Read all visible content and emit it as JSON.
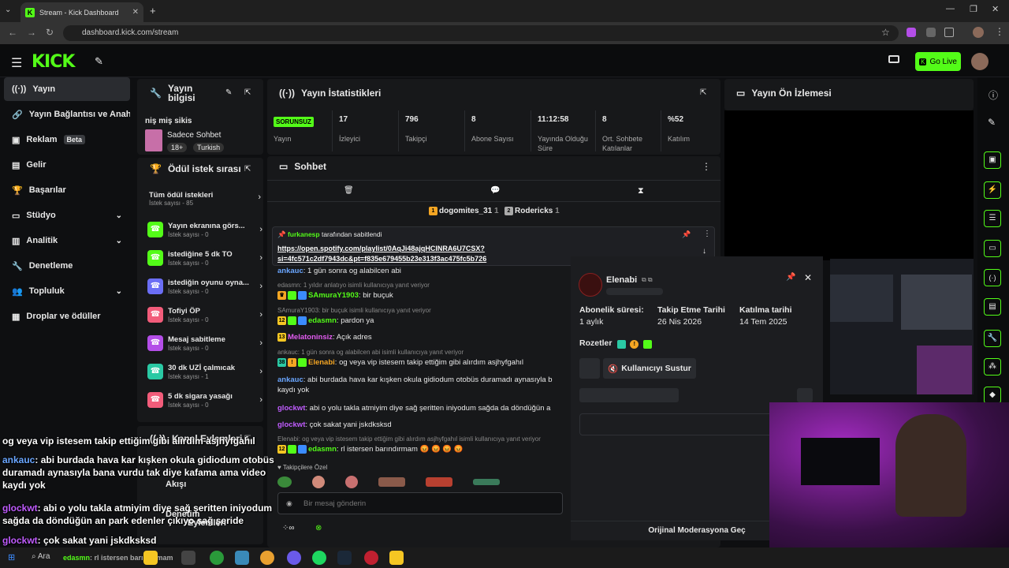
{
  "browser": {
    "tab_title": "Stream - Kick Dashboard",
    "url": "dashboard.kick.com/stream"
  },
  "header": {
    "logo": "KICK",
    "go_live": "Go Live"
  },
  "sidebar": {
    "items": [
      {
        "label": "Yayın",
        "icon": "broadcast-icon"
      },
      {
        "label": "Yayın Bağlantısı ve Anahtarı",
        "icon": "link-icon"
      },
      {
        "label": "Reklam",
        "icon": "ad-icon",
        "badge": "Beta"
      },
      {
        "label": "Gelir",
        "icon": "wallet-icon"
      },
      {
        "label": "Başarılar",
        "icon": "trophy-icon"
      },
      {
        "label": "Stüdyo",
        "icon": "studio-icon"
      },
      {
        "label": "Analitik",
        "icon": "chart-icon"
      },
      {
        "label": "Denetleme",
        "icon": "wrench-icon"
      },
      {
        "label": "Topluluk",
        "icon": "community-icon"
      },
      {
        "label": "Droplar ve ödüller",
        "icon": "drops-icon"
      }
    ]
  },
  "stream_info": {
    "title": "Yayın bilgisi",
    "stream_title": "niş miş sikis",
    "category": "Sadece Sohbet",
    "tags": [
      "18+",
      "Turkish"
    ]
  },
  "rewards": {
    "title": "Ödül istek sırası",
    "all_label": "Tüm ödül istekleri",
    "all_count": "İstek sayısı - 85",
    "items": [
      {
        "label": "Yayın ekranına görs...",
        "count": "İstek sayısı - 0",
        "color": "#53fc18"
      },
      {
        "label": "istediğine 5 dk TO",
        "count": "İstek sayısı - 0",
        "color": "#53fc18"
      },
      {
        "label": "istediğin oyunu oyna...",
        "count": "İstek sayısı - 0",
        "color": "#6b6ef5"
      },
      {
        "label": "Tofiyi ÖP",
        "count": "İstek sayısı - 0",
        "color": "#f25c7a"
      },
      {
        "label": "Mesaj sabitleme",
        "count": "İstek sayısı - 0",
        "color": "#b44ee8"
      },
      {
        "label": "30 dk UZİ çalmıcak",
        "count": "İstek sayısı - 1",
        "color": "#2ac9a4"
      },
      {
        "label": "5 dk sigara yasağı",
        "count": "İstek sayısı - 0",
        "color": "#f25c7a"
      }
    ]
  },
  "channel_actions": {
    "title": "Kanal Eylemleri"
  },
  "stats": {
    "title": "Yayın İstatistikleri",
    "items": [
      {
        "value": "SORUNSUZ",
        "label": "Yayın"
      },
      {
        "value": "17",
        "label": "İzleyici"
      },
      {
        "value": "796",
        "label": "Takipçi"
      },
      {
        "value": "8",
        "label": "Abone Sayısı"
      },
      {
        "value": "11:12:58",
        "label": "Yayında Olduğu Süre"
      },
      {
        "value": "8",
        "label": "Ort. Sohbete Katılanlar"
      },
      {
        "value": "%52",
        "label": "Katılım"
      }
    ]
  },
  "preview": {
    "title": "Yayın Ön İzlemesi"
  },
  "chat": {
    "title": "Sohbet",
    "top_gifters": [
      {
        "name": "dogomites_31",
        "count": "1"
      },
      {
        "name": "Rodericks",
        "count": "1"
      }
    ],
    "pinned_by": "furkanesp",
    "pinned_suffix": "tarafından sabitlendi",
    "pinned_link_1": "https://open.spotify.com/playlist/0AqJi48ajqHCINRA6U7CSX?",
    "pinned_link_2": "si=4fc571c2df7943dc&pt=f835e679455b23e313f3ac475fc5b726",
    "messages": [
      {
        "reply": "",
        "user": "ankauc",
        "text": "1 gün sonra og alabilcen abi",
        "color": "#6aa6ff"
      },
      {
        "reply": "edasmn: 1 yıldır anlatıyo isimli kullanıcıya yanıt veriyor",
        "user": "SAmuraY1903",
        "text": "bir buçuk",
        "color": "#53fc18"
      },
      {
        "reply": "SAmuraY1903: bir buçuk isimli kullanıcıya yanıt veriyor",
        "user": "edasmn",
        "text": "pardon ya",
        "color": "#53fc18"
      },
      {
        "reply": "",
        "user": "Melatoninsiz",
        "text": "Açık adres",
        "color": "#e25cf0"
      },
      {
        "reply": "ankauc: 1 gün sonra og alabilcen abi isimli kullanıcıya yanıt veriyor",
        "user": "Elenabi",
        "text": "og veya vip istesem takip ettiğim gibi alırdım asjhyfgahıl",
        "color": "#f5a623"
      },
      {
        "reply": "",
        "user": "ankauc",
        "text": "abi burdada hava kar kışken okula gidiodum otobüs duramadı aynasıyla b",
        "text2": "kaydı yok",
        "color": "#6aa6ff"
      },
      {
        "reply": "",
        "user": "glockwt",
        "text": "abi o yolu takla atmiyim diye sağ şeritten iniyodum sağda da döndüğün a",
        "color": "#c05cff"
      },
      {
        "reply": "",
        "user": "glockwt",
        "text": "çok sakat yani jskdksksd",
        "color": "#c05cff"
      },
      {
        "reply": "Elenabi: og veya vip istesem takip ettiğim gibi alırdım asjhyfgahıl isimli kullanıcıya yanıt veriyor",
        "user": "edasmn",
        "text": "rl istersen barındırmam 😡 😡 😡 😡",
        "color": "#53fc18"
      }
    ],
    "followers_only": "Takipçilere Özel",
    "input_placeholder": "Bir mesaj gönderin"
  },
  "profile": {
    "username": "Elenabi",
    "sub_label": "Abonelik süresi:",
    "sub_value": "1 aylık",
    "follow_label": "Takip Etme Tarihi",
    "follow_value": "26 Nis 2026",
    "join_label": "Katılma tarihi",
    "join_value": "14 Tem 2025",
    "badges_label": "Rozetler",
    "mute_button": "Kullanıcıyı Sustur",
    "footer_button": "Orijinal Moderasyona Geç"
  },
  "overlay_chat": [
    {
      "user": "edasmn",
      "text": "",
      "color": "#53fc18"
    },
    {
      "user": "Elenabi",
      "text": "og veya vip istesem takip ettiğim gibi alırdım asjhyfgahıl",
      "color": "#f5a623"
    },
    {
      "user": "ankauc",
      "text": ": abi burdada hava kar kışken okula gidiodum otobüs",
      "text2": "duramadı aynasıyla bana vurdu tak diye kafama ama video",
      "text3": "kaydı yok",
      "color": "#6aa6ff"
    },
    {
      "user": "glockwt",
      "text": ": abi o yolu takla atmiyim diye sağ şeritten iniyodum",
      "text2": "sağda da döndüğün an park edenler çıkıyo sağ şeride",
      "color": "#c05cff"
    },
    {
      "user": "glockwt",
      "text": ": çok sakat yani jskdksksd",
      "color": "#c05cff"
    },
    {
      "user": "edasmn",
      "text": ": rl istersen barındırmam",
      "color": "#53fc18"
    }
  ],
  "overlay_misc": {
    "akis": "Akışı",
    "denetim": "Denetim",
    "eylemleri": "Eylemleri"
  },
  "taskbar": {
    "search": "Ara"
  }
}
